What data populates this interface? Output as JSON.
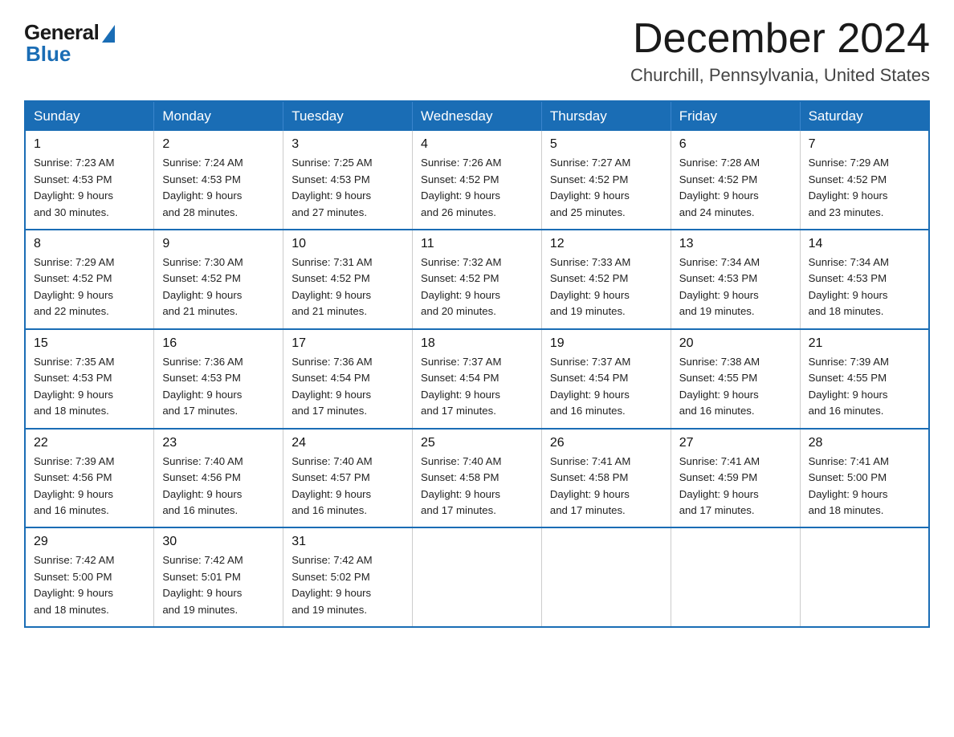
{
  "logo": {
    "general": "General",
    "blue": "Blue"
  },
  "header": {
    "month": "December 2024",
    "location": "Churchill, Pennsylvania, United States"
  },
  "weekdays": [
    "Sunday",
    "Monday",
    "Tuesday",
    "Wednesday",
    "Thursday",
    "Friday",
    "Saturday"
  ],
  "weeks": [
    [
      {
        "day": "1",
        "sunrise": "7:23 AM",
        "sunset": "4:53 PM",
        "daylight": "9 hours and 30 minutes."
      },
      {
        "day": "2",
        "sunrise": "7:24 AM",
        "sunset": "4:53 PM",
        "daylight": "9 hours and 28 minutes."
      },
      {
        "day": "3",
        "sunrise": "7:25 AM",
        "sunset": "4:53 PM",
        "daylight": "9 hours and 27 minutes."
      },
      {
        "day": "4",
        "sunrise": "7:26 AM",
        "sunset": "4:52 PM",
        "daylight": "9 hours and 26 minutes."
      },
      {
        "day": "5",
        "sunrise": "7:27 AM",
        "sunset": "4:52 PM",
        "daylight": "9 hours and 25 minutes."
      },
      {
        "day": "6",
        "sunrise": "7:28 AM",
        "sunset": "4:52 PM",
        "daylight": "9 hours and 24 minutes."
      },
      {
        "day": "7",
        "sunrise": "7:29 AM",
        "sunset": "4:52 PM",
        "daylight": "9 hours and 23 minutes."
      }
    ],
    [
      {
        "day": "8",
        "sunrise": "7:29 AM",
        "sunset": "4:52 PM",
        "daylight": "9 hours and 22 minutes."
      },
      {
        "day": "9",
        "sunrise": "7:30 AM",
        "sunset": "4:52 PM",
        "daylight": "9 hours and 21 minutes."
      },
      {
        "day": "10",
        "sunrise": "7:31 AM",
        "sunset": "4:52 PM",
        "daylight": "9 hours and 21 minutes."
      },
      {
        "day": "11",
        "sunrise": "7:32 AM",
        "sunset": "4:52 PM",
        "daylight": "9 hours and 20 minutes."
      },
      {
        "day": "12",
        "sunrise": "7:33 AM",
        "sunset": "4:52 PM",
        "daylight": "9 hours and 19 minutes."
      },
      {
        "day": "13",
        "sunrise": "7:34 AM",
        "sunset": "4:53 PM",
        "daylight": "9 hours and 19 minutes."
      },
      {
        "day": "14",
        "sunrise": "7:34 AM",
        "sunset": "4:53 PM",
        "daylight": "9 hours and 18 minutes."
      }
    ],
    [
      {
        "day": "15",
        "sunrise": "7:35 AM",
        "sunset": "4:53 PM",
        "daylight": "9 hours and 18 minutes."
      },
      {
        "day": "16",
        "sunrise": "7:36 AM",
        "sunset": "4:53 PM",
        "daylight": "9 hours and 17 minutes."
      },
      {
        "day": "17",
        "sunrise": "7:36 AM",
        "sunset": "4:54 PM",
        "daylight": "9 hours and 17 minutes."
      },
      {
        "day": "18",
        "sunrise": "7:37 AM",
        "sunset": "4:54 PM",
        "daylight": "9 hours and 17 minutes."
      },
      {
        "day": "19",
        "sunrise": "7:37 AM",
        "sunset": "4:54 PM",
        "daylight": "9 hours and 16 minutes."
      },
      {
        "day": "20",
        "sunrise": "7:38 AM",
        "sunset": "4:55 PM",
        "daylight": "9 hours and 16 minutes."
      },
      {
        "day": "21",
        "sunrise": "7:39 AM",
        "sunset": "4:55 PM",
        "daylight": "9 hours and 16 minutes."
      }
    ],
    [
      {
        "day": "22",
        "sunrise": "7:39 AM",
        "sunset": "4:56 PM",
        "daylight": "9 hours and 16 minutes."
      },
      {
        "day": "23",
        "sunrise": "7:40 AM",
        "sunset": "4:56 PM",
        "daylight": "9 hours and 16 minutes."
      },
      {
        "day": "24",
        "sunrise": "7:40 AM",
        "sunset": "4:57 PM",
        "daylight": "9 hours and 16 minutes."
      },
      {
        "day": "25",
        "sunrise": "7:40 AM",
        "sunset": "4:58 PM",
        "daylight": "9 hours and 17 minutes."
      },
      {
        "day": "26",
        "sunrise": "7:41 AM",
        "sunset": "4:58 PM",
        "daylight": "9 hours and 17 minutes."
      },
      {
        "day": "27",
        "sunrise": "7:41 AM",
        "sunset": "4:59 PM",
        "daylight": "9 hours and 17 minutes."
      },
      {
        "day": "28",
        "sunrise": "7:41 AM",
        "sunset": "5:00 PM",
        "daylight": "9 hours and 18 minutes."
      }
    ],
    [
      {
        "day": "29",
        "sunrise": "7:42 AM",
        "sunset": "5:00 PM",
        "daylight": "9 hours and 18 minutes."
      },
      {
        "day": "30",
        "sunrise": "7:42 AM",
        "sunset": "5:01 PM",
        "daylight": "9 hours and 19 minutes."
      },
      {
        "day": "31",
        "sunrise": "7:42 AM",
        "sunset": "5:02 PM",
        "daylight": "9 hours and 19 minutes."
      },
      null,
      null,
      null,
      null
    ]
  ],
  "labels": {
    "sunrise": "Sunrise:",
    "sunset": "Sunset:",
    "daylight": "Daylight:"
  }
}
